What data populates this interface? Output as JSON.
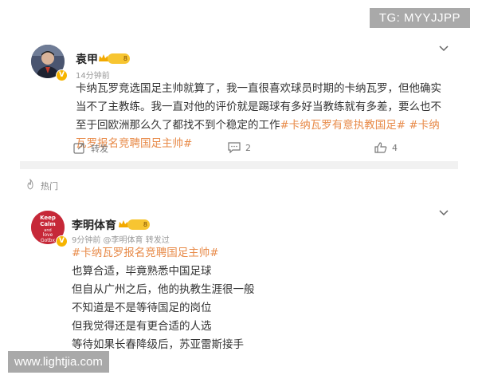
{
  "watermarks": {
    "top": "TG: MYYJJPP",
    "bottom": "www.lightjia.com"
  },
  "post1": {
    "author": "袁甲",
    "level": "8",
    "verified": "V",
    "time": "14分钟前",
    "text_main": "卡纳瓦罗竞选国足主帅就算了，我一直很喜欢球员时期的卡纳瓦罗，但他确实当不了主教练。我一直对他的评价就是踢球有多好当教练就有多差，要么也不至于回欧洲那么久了都找不到个稳定的工作",
    "tag1": "#卡纳瓦罗有意执教国足#",
    "tag2": "#卡纳瓦罗报名竞聘国足主帅#",
    "repost_label": "转发",
    "comments": "2",
    "likes": "4"
  },
  "hot_label": "热门",
  "post2": {
    "author": "李明体育",
    "level": "8",
    "verified": "V",
    "meta": "9分钟前 @李明体育 转发过",
    "avatar_text": [
      "Keep",
      "Calm",
      "and",
      "love",
      "Gotbx"
    ],
    "tag": "#卡纳瓦罗报名竞聘国足主帅#",
    "lines": [
      "也算合适，毕竟熟悉中国足球",
      "但自从广州之后，他的执教生涯很一般",
      "不知道是不是等待国足的岗位",
      "但我觉得还是有更合适的人选",
      "等待如果长春降级后，苏亚雷斯接手"
    ]
  },
  "colors": {
    "tag": "#e88b4a",
    "badge": "#f6b400",
    "gap": "#f1f1f1"
  }
}
